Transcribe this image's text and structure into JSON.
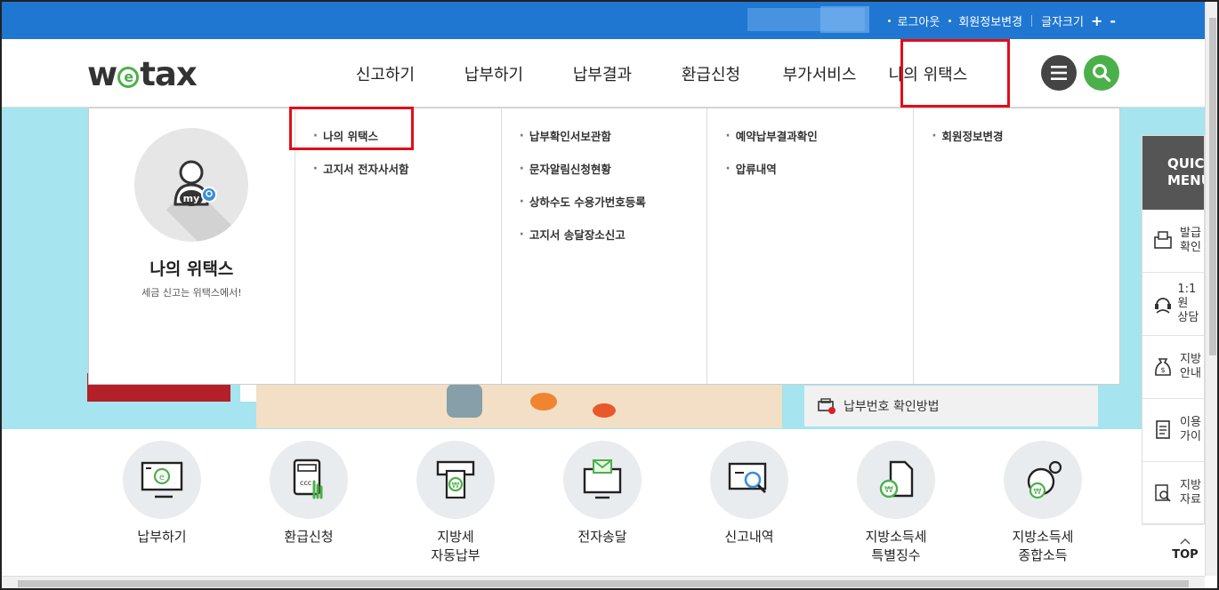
{
  "utility": {
    "logout": "로그아웃",
    "member_edit": "회원정보변경",
    "font_size": "글자크기",
    "plus": "+",
    "minus": "-"
  },
  "logo": {
    "pre": "w",
    "e": "e",
    "post": "tax"
  },
  "gnb": [
    {
      "label": "신고하기"
    },
    {
      "label": "납부하기"
    },
    {
      "label": "납부결과"
    },
    {
      "label": "환급신청"
    },
    {
      "label": "부가서비스"
    },
    {
      "label": "나의 위택스"
    }
  ],
  "dropdown": {
    "title": "나의 위택스",
    "subtitle": "세금 신고는 위택스에서!",
    "avatar_text": "my",
    "col1": [
      "나의 위택스",
      "고지서 전자사서함"
    ],
    "col2": [
      "납부확인서보관함",
      "문자알림신청현황",
      "상하수도 수용가번호등록",
      "고지서 송달장소신고"
    ],
    "col3": [
      "예약납부결과확인",
      "압류내역"
    ],
    "col4": [
      "회원정보변경"
    ]
  },
  "notice": {
    "label": "납부번호 확인방법"
  },
  "quick_menu": {
    "title": "QUICK\nMENU",
    "items": [
      {
        "text": "발급\n확인",
        "icon": "document-print-icon"
      },
      {
        "text": "1:1원\n상담",
        "icon": "headset-icon"
      },
      {
        "text": "지방\n안내",
        "icon": "money-bag-icon"
      },
      {
        "text": "이용\n가이",
        "icon": "guide-doc-icon"
      },
      {
        "text": "지방\n자료",
        "icon": "data-search-icon"
      }
    ],
    "top_label": "TOP"
  },
  "services": [
    {
      "label": "납부하기",
      "icon": "monitor-pay-icon"
    },
    {
      "label": "환급신청",
      "icon": "calculator-hand-icon"
    },
    {
      "label": "지방세\n자동납부",
      "icon": "auto-pay-icon"
    },
    {
      "label": "전자송달",
      "icon": "email-monitor-icon"
    },
    {
      "label": "신고내역",
      "icon": "report-search-icon"
    },
    {
      "label": "지방소득세\n특별징수",
      "icon": "special-tax-icon"
    },
    {
      "label": "지방소득세\n종합소득",
      "icon": "income-tax-icon"
    }
  ],
  "colors": {
    "topbar": "#1f77d2",
    "accent_green": "#4cb04a",
    "highlight_red": "#e30d17",
    "band": "#a6e4ef"
  }
}
